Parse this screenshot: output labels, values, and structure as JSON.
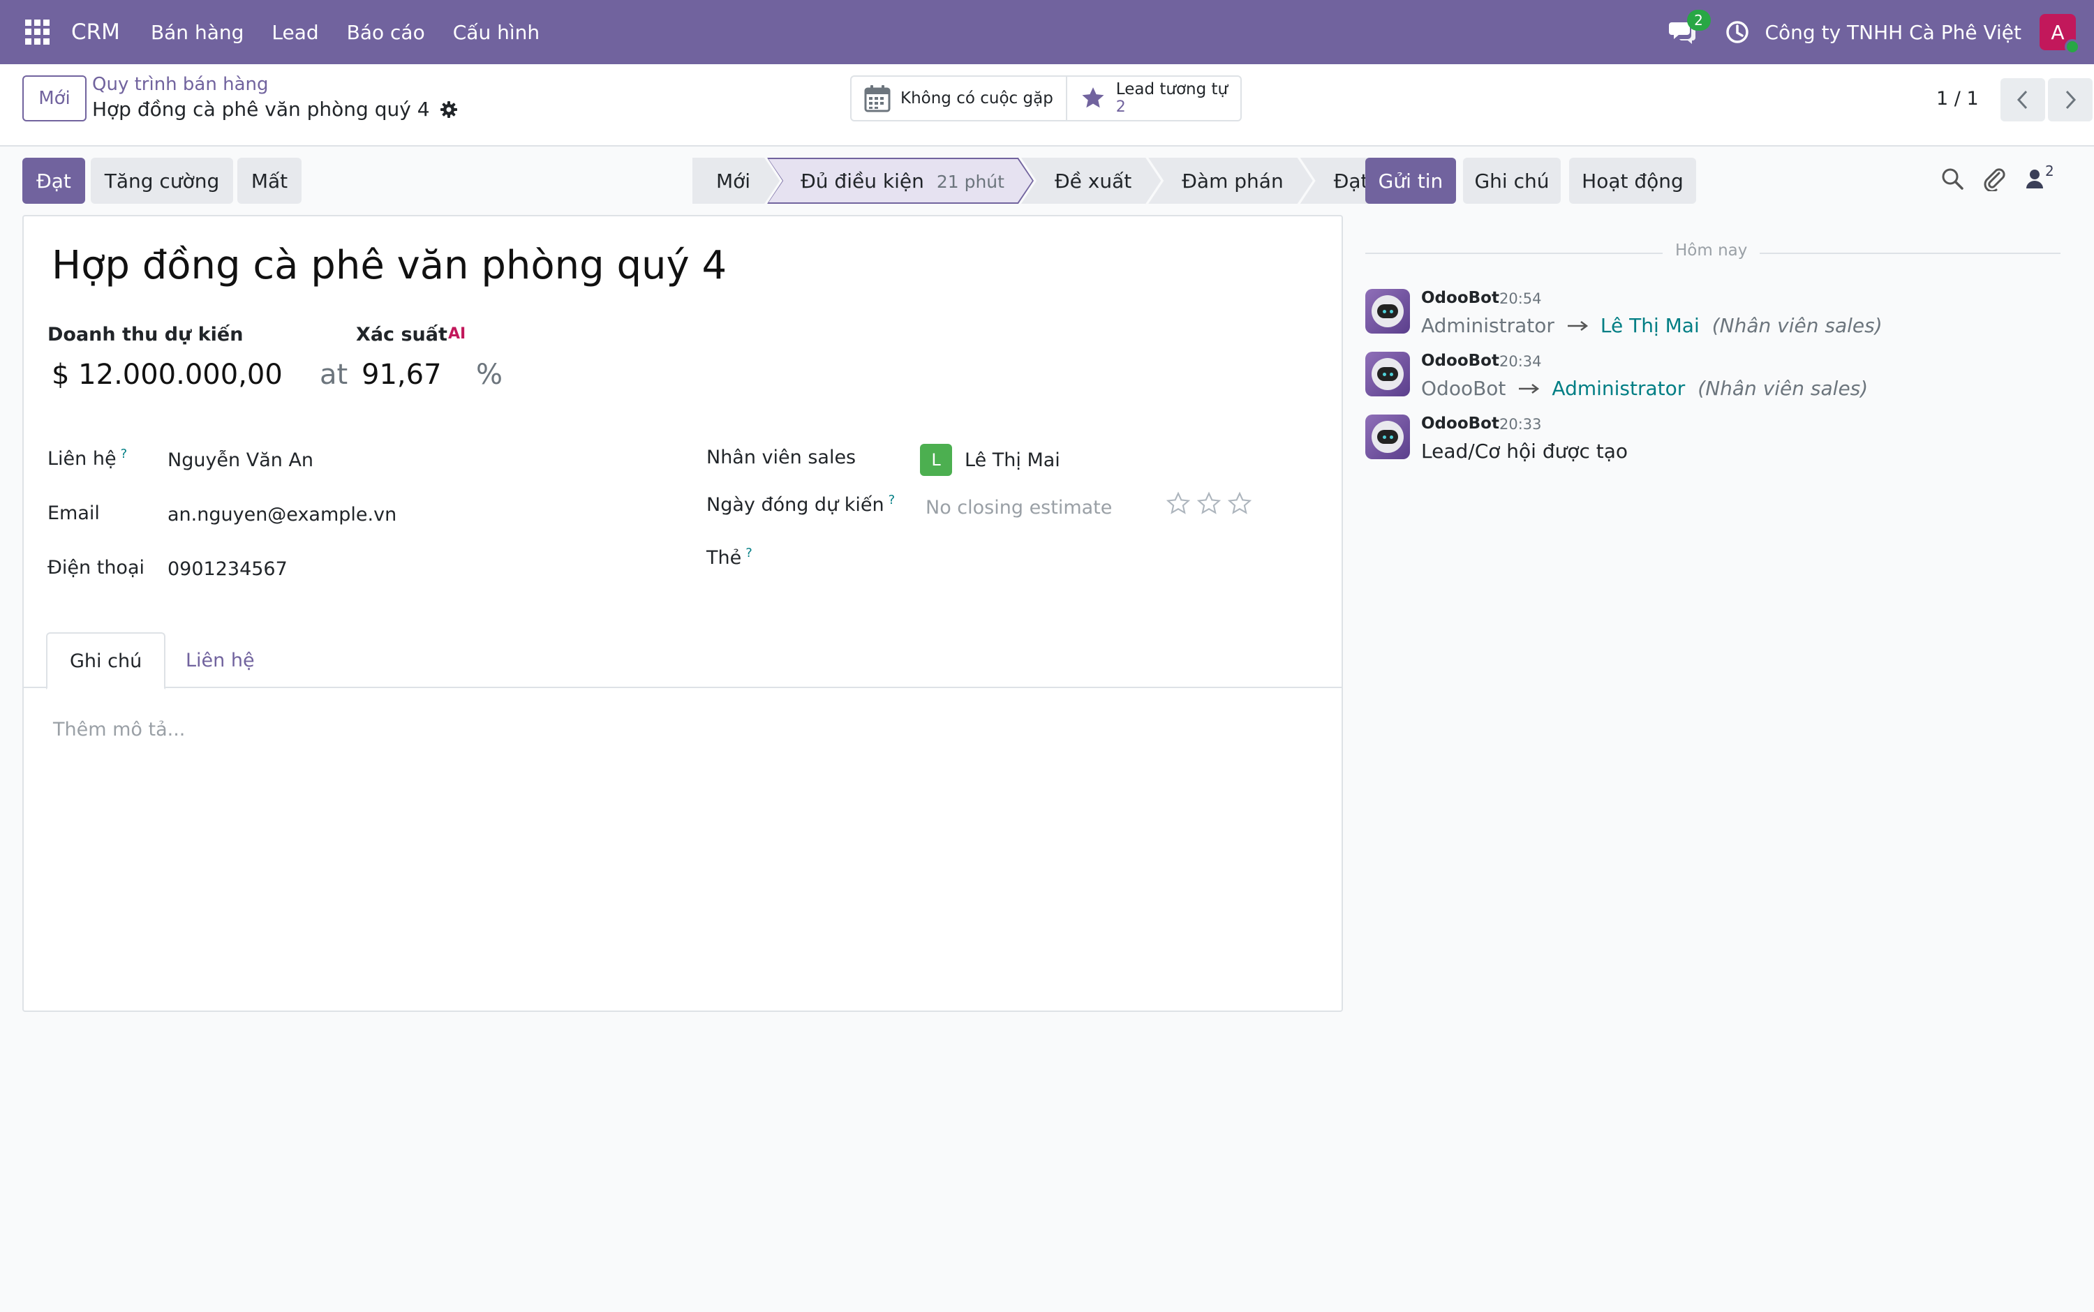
{
  "navbar": {
    "brand": "CRM",
    "menu": [
      "Bán hàng",
      "Lead",
      "Báo cáo",
      "Cấu hình"
    ],
    "chat_badge": "2",
    "company": "Công ty TNHH Cà Phê Việt",
    "avatar_letter": "A",
    "color": "#71639e"
  },
  "control": {
    "new_button": "Mới",
    "breadcrumb_parent": "Quy trình bán hàng",
    "breadcrumb_current": "Hợp đồng cà phê văn phòng quý 4",
    "meetings_label": "Không có cuộc gặp",
    "similar_leads_label": "Lead tương tự",
    "similar_leads_count": "2",
    "pager": "1 / 1"
  },
  "header_buttons": {
    "won": "Đạt",
    "enrich": "Tăng cường",
    "lost": "Mất"
  },
  "stages": [
    {
      "label": "Mới"
    },
    {
      "label": "Đủ điều kiện",
      "duration": "21 phút",
      "active": true
    },
    {
      "label": "Đề xuất"
    },
    {
      "label": "Đàm phán"
    },
    {
      "label": "Đạt"
    }
  ],
  "form": {
    "title": "Hợp đồng cà phê văn phòng quý 4",
    "expected_revenue_label": "Doanh thu dự kiến",
    "expected_revenue_value": "$ 12.000.000,00",
    "at_text": "at",
    "probability_label": "Xác suất",
    "probability_value": "91,67",
    "percent": "%",
    "ai_badge": "AI",
    "contact_label": "Liên hệ",
    "contact_value": "Nguyễn Văn An",
    "email_label": "Email",
    "email_value": "an.nguyen@example.vn",
    "phone_label": "Điện thoại",
    "phone_value": "0901234567",
    "salesperson_label": "Nhân viên sales",
    "salesperson_initial": "L",
    "salesperson_value": "Lê Thị Mai",
    "closing_label": "Ngày đóng dự kiến",
    "closing_placeholder": "No closing estimate",
    "tags_label": "Thẻ",
    "help_mark": "?",
    "tabs": [
      "Ghi chú",
      "Liên hệ"
    ],
    "description_placeholder": "Thêm mô tả..."
  },
  "chatter": {
    "send_message": "Gửi tin",
    "log_note": "Ghi chú",
    "activity": "Hoạt động",
    "followers_count": "2",
    "day_label": "Hôm nay",
    "messages": [
      {
        "author": "OdooBot",
        "time": "20:54",
        "old": "Administrator",
        "new": "Lê Thị Mai",
        "field": "(Nhân viên sales)"
      },
      {
        "author": "OdooBot",
        "time": "20:34",
        "old": "OdooBot",
        "new": "Administrator",
        "field": "(Nhân viên sales)"
      },
      {
        "author": "OdooBot",
        "time": "20:33",
        "body": "Lead/Cơ hội được tạo"
      }
    ]
  }
}
